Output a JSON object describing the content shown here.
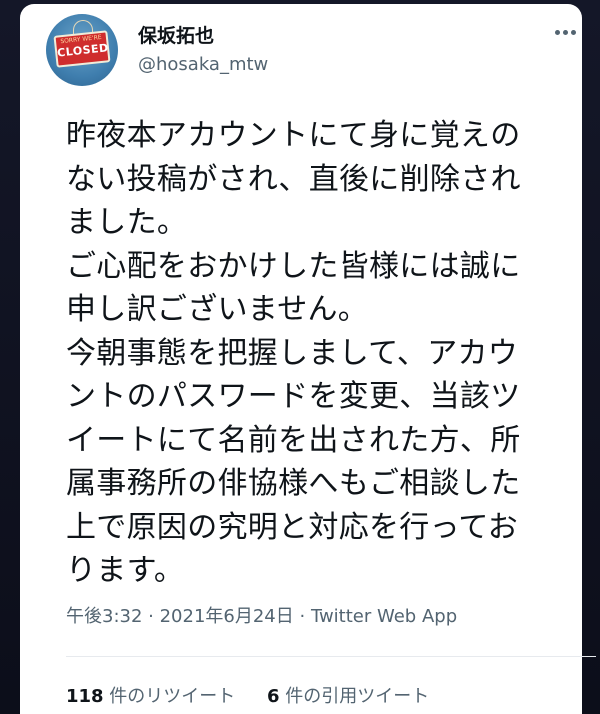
{
  "tweet": {
    "display_name": "保坂拓也",
    "handle": "@hosaka_mtw",
    "avatar": {
      "sign_small_text": "SORRY WE'RE",
      "sign_big_text": "CLOSED"
    },
    "more_icon": "more-horizontal-icon",
    "text_lines": [
      "昨夜本アカウントにて身に覚えの",
      "ない投稿がされ、直後に削除され",
      "ました。",
      "ご心配をおかけした皆様には誠に",
      "申し訳ございません。",
      "今朝事態を把握しまして、アカウ",
      "ントのパスワードを変更、当該ツ",
      "イートにて名前を出された方、所",
      "属事務所の俳協様へもご相談した",
      "上で原因の究明と対応を行ってお",
      "ります。"
    ],
    "time": "午後3:32",
    "date": "2021年6月24日",
    "source": "Twitter Web App",
    "separator": " · ",
    "retweets": {
      "count": "118",
      "label": " 件のリツイート"
    },
    "quotes": {
      "count": "6",
      "label": " 件の引用ツイート"
    }
  }
}
